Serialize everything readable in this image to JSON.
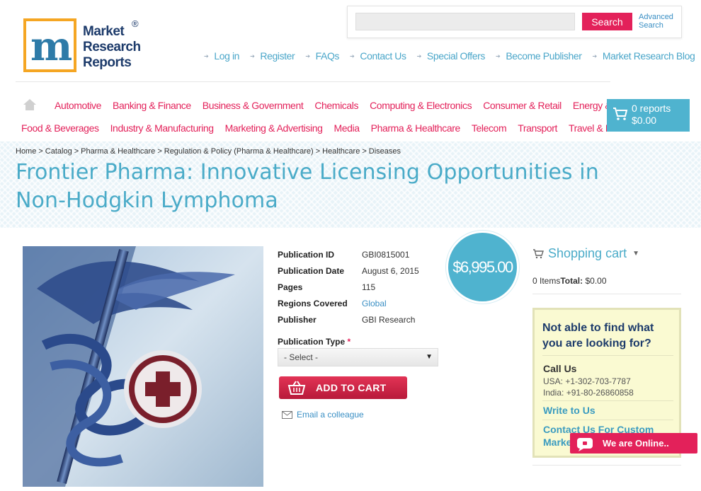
{
  "logo": {
    "text_lines": [
      "Market",
      "Research",
      "Reports"
    ],
    "registered": "®"
  },
  "search": {
    "placeholder": "",
    "button": "Search",
    "advanced": "Advanced Search"
  },
  "top_links": [
    "Log in",
    "Register",
    "FAQs",
    "Contact Us",
    "Special Offers",
    "Become Publisher",
    "Market Research Blog"
  ],
  "categories_row1": [
    "Automotive",
    "Banking & Finance",
    "Business & Government",
    "Chemicals",
    "Computing & Electronics",
    "Consumer & Retail",
    "Energy & Utilities"
  ],
  "categories_row2": [
    "Food & Beverages",
    "Industry & Manufacturing",
    "Marketing & Advertising",
    "Media",
    "Pharma & Healthcare",
    "Telecom",
    "Transport",
    "Travel & Leisure"
  ],
  "header_cart": {
    "count": "0 reports",
    "total": "$0.00"
  },
  "breadcrumb": [
    "Home",
    "Catalog",
    "Pharma & Healthcare",
    "Regulation & Policy (Pharma & Healthcare)",
    "Healthcare",
    "Diseases"
  ],
  "page_title": "Frontier Pharma: Innovative Licensing Opportunities in Non-Hodgkin Lymphoma",
  "product": {
    "details": [
      {
        "label": "Publication ID",
        "value": "GBI0815001"
      },
      {
        "label": "Publication Date",
        "value": "August 6, 2015"
      },
      {
        "label": "Pages",
        "value": "115"
      },
      {
        "label": "Regions Covered",
        "value": "Global"
      },
      {
        "label": "Publisher",
        "value": "GBI Research"
      }
    ],
    "pub_type_label": "Publication Type",
    "pub_type_required": "*",
    "pub_type_selected": "- Select -",
    "add_to_cart": "ADD TO CART",
    "email_colleague": "Email a colleague",
    "price": "$6,995.00"
  },
  "sidebar": {
    "shopping_cart": "Shopping cart",
    "items_label": "0 Items",
    "total_label": "Total:",
    "total_value": "$0.00",
    "help_title": "Not able to find what you are looking for?",
    "call_us": "Call Us",
    "phone_usa": "USA: +1-302-703-7787",
    "phone_india": "India: +91-80-26860858",
    "write_us": "Write to Us",
    "contact_custom": "Contact Us For Custom Market"
  },
  "chat": {
    "label": "We are Online.."
  },
  "colors": {
    "accent_pink": "#e3215a",
    "accent_blue": "#4fb3cf",
    "link_blue": "#3a8fc4"
  }
}
